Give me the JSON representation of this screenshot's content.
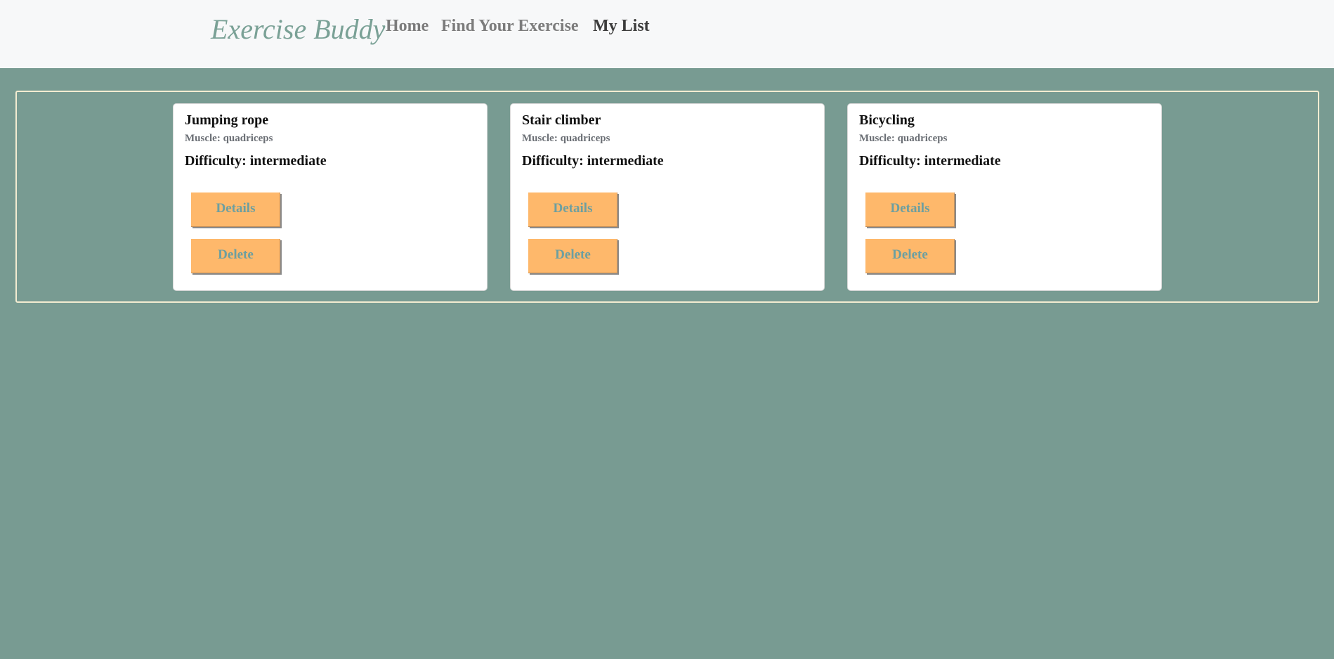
{
  "navbar": {
    "brand": "Exercise Buddy",
    "links": [
      {
        "label": "Home"
      },
      {
        "label": "Find Your Exercise"
      },
      {
        "label": "My List"
      }
    ]
  },
  "cards": [
    {
      "name": "Jumping rope",
      "muscle": "Muscle: quadriceps",
      "difficulty": "Difficulty:  intermediate",
      "details_label": "Details",
      "delete_label": "Delete"
    },
    {
      "name": "Stair climber",
      "muscle": "Muscle: quadriceps",
      "difficulty": "Difficulty:  intermediate",
      "details_label": "Details",
      "delete_label": "Delete"
    },
    {
      "name": "Bicycling",
      "muscle": "Muscle: quadriceps",
      "difficulty": "Difficulty:  intermediate",
      "details_label": "Details",
      "delete_label": "Delete"
    }
  ],
  "colors": {
    "background": "#789b92",
    "navbar": "#f7f8f9",
    "brand": "#7aa196",
    "button": "#feb86b",
    "button_text": "#6d9fa0",
    "container_border": "#f3ecd1"
  }
}
